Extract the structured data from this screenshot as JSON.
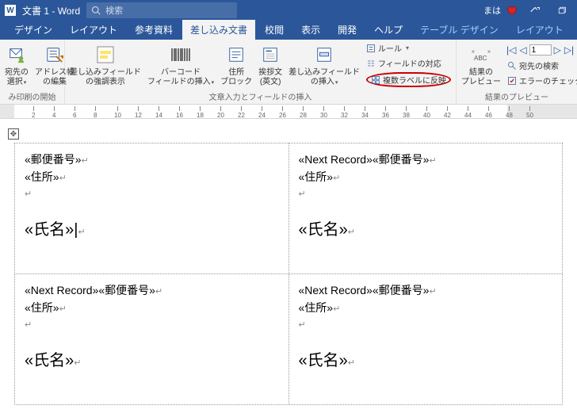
{
  "titlebar": {
    "doc_title": "文書 1",
    "app_name": "Word",
    "search_placeholder": "検索",
    "user_name": "まは"
  },
  "tabs": {
    "items": [
      {
        "label": "デザイン"
      },
      {
        "label": "レイアウト"
      },
      {
        "label": "参考資料"
      },
      {
        "label": "差し込み文書",
        "active": true
      },
      {
        "label": "校閲"
      },
      {
        "label": "表示"
      },
      {
        "label": "開発"
      },
      {
        "label": "ヘルプ"
      },
      {
        "label": "テーブル デザイン",
        "kind": "context"
      },
      {
        "label": "レイアウト",
        "kind": "context"
      }
    ]
  },
  "ribbon": {
    "group_start": {
      "btn_select_recipients": "宛先の\n選択",
      "btn_edit_addresses": "アドレス帳\nの編集",
      "label": "み印刷の開始"
    },
    "group_fields": {
      "btn_highlight": "差し込みフィールド\nの強調表示",
      "btn_barcode": "バーコード\nフィールドの挿入",
      "btn_address_block": "住所\nブロック",
      "btn_greeting": "挨拶文\n(英文)",
      "btn_insert_merge": "差し込みフィールド\nの挿入",
      "opt_rules": "ルール",
      "opt_match_fields": "フィールドの対応",
      "opt_update_labels": "複数ラベルに反映",
      "label": "文章入力とフィールドの挿入"
    },
    "group_preview": {
      "btn_preview": "結果の\nプレビュー",
      "record_value": "1",
      "opt_find_recipient": "宛先の検索",
      "opt_error_check": "エラーのチェック",
      "label": "結果のプレビュー"
    }
  },
  "ruler": {
    "ticks": [
      2,
      4,
      6,
      8,
      10,
      12,
      14,
      16,
      18,
      20,
      22,
      24,
      26,
      28,
      30,
      32,
      34,
      36,
      38,
      40,
      42,
      44,
      46,
      48,
      50
    ]
  },
  "labels": {
    "postal": "«郵便番号»",
    "address": "«住所»",
    "name": "«氏名»",
    "next_record": "«Next Record»",
    "cursor": "Ӏ"
  }
}
